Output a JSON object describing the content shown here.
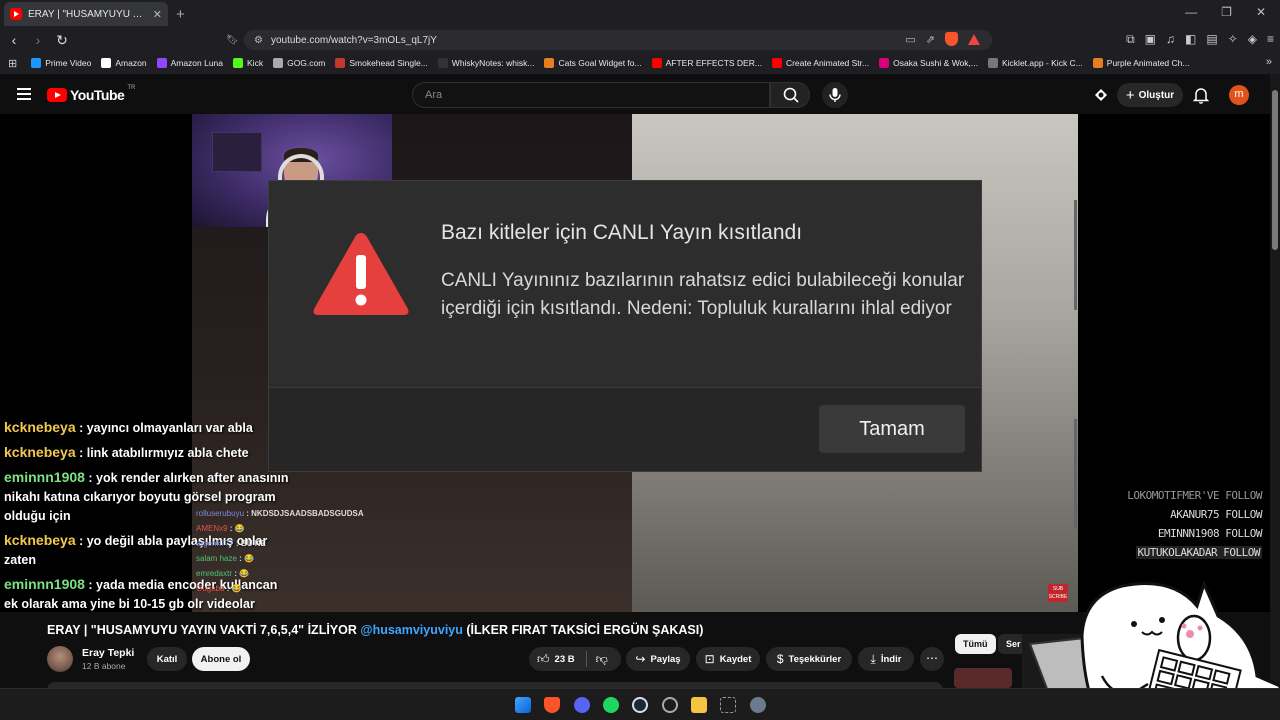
{
  "browser": {
    "tab_title": "ERAY | \"HUSAMYUYU YAYIN VAKT...",
    "url": "youtube.com/watch?v=3mOLs_qL7jY",
    "bookmarks": [
      {
        "label": "Prime Video",
        "color": "#1a98ff"
      },
      {
        "label": "Amazon",
        "color": "#ffffff"
      },
      {
        "label": "Amazon Luna",
        "color": "#9146ff"
      },
      {
        "label": "Kick",
        "color": "#53fc18"
      },
      {
        "label": "GOG.com",
        "color": "#aaaaaa"
      },
      {
        "label": "Smokehead Single...",
        "color": "#c0392b"
      },
      {
        "label": "WhiskyNotes: whisk...",
        "color": "#333333"
      },
      {
        "label": "Cats Goal Widget fo...",
        "color": "#e67e22"
      },
      {
        "label": "AFTER EFFECTS DER...",
        "color": "#ff0000"
      },
      {
        "label": "Create Animated Str...",
        "color": "#ff0000"
      },
      {
        "label": "Osaka Sushi & Wok,...",
        "color": "#d6007e"
      },
      {
        "label": "Kicklet.app - Kick C...",
        "color": "#777777"
      },
      {
        "label": "Purple Animated Ch...",
        "color": "#e67e22"
      }
    ]
  },
  "youtube": {
    "logo_text": "YouTube",
    "logo_suffix": "TR",
    "search_placeholder": "Ara",
    "create_label": "Oluştur",
    "avatar_letter": "m"
  },
  "dialog": {
    "title": "Bazı kitleler için CANLI Yayın kısıtlandı",
    "body": "CANLI Yayınınız bazılarının rahatsız edici bulabileceği konular içerdiği için kısıtlandı. Nedeni: Topluluk kurallarını ihlal ediyor",
    "ok_label": "Tamam"
  },
  "overlay_chat": [
    {
      "user": "kcknebeya",
      "color": "yellow",
      "text": " : yayıncı olmayanları var abla"
    },
    {
      "user": "kcknebeya",
      "color": "yellow",
      "text": " : link atabılırmıyız abla chete"
    },
    {
      "user": "eminnn1908",
      "color": "green",
      "text": " : yok render alırken after anasının nikahı katına cıkarıyor boyutu görsel program olduğu için"
    },
    {
      "user": "kcknebeya",
      "color": "yellow",
      "text": " : yo değil abla paylaşılmış onlar zaten"
    },
    {
      "user": "eminnn1908",
      "color": "green",
      "text": " : yada media encoder kullancan ek olarak ama yine bi 10-15 gb olr videolar"
    }
  ],
  "mini_chat": [
    {
      "user": "rolluserubuyu",
      "text": " : NKDSDJSAADSBADSGUDSA"
    },
    {
      "user": "AMENx9",
      "text": " : 😂"
    },
    {
      "user": "ergenk777",
      "text": " : BU NE"
    },
    {
      "user": "salam haze",
      "text": " : 😂"
    },
    {
      "user": "emredaxtr",
      "text": " : 😂"
    },
    {
      "user": "Gugaba",
      "text": " : 😂"
    }
  ],
  "follows": [
    {
      "text": "LOKOMOTIFMER'VE FOLLOW",
      "style": "dim"
    },
    {
      "text": "AKANUR75 FOLLOW",
      "style": "normal"
    },
    {
      "text": "EMINNN1908 FOLLOW",
      "style": "normal"
    },
    {
      "text": "KUTUKOLAKADAR FOLLOW",
      "style": "hl"
    }
  ],
  "sub_badge": "SUB SCRIBE",
  "video": {
    "title_main": "ERAY | \"HUSAMYUYU YAYIN VAKTİ 7,6,5,4\" İZLİYOR ",
    "title_mention": "@husamviyuviyu",
    "title_tail": " (İLKER FIRAT TAKSİCİ ERGÜN ŞAKASI)",
    "channel_name": "Eray Tepki",
    "channel_subs": "12 B abone",
    "join_label": "Katıl",
    "subscribe_label": "Abone ol",
    "likes": "23 B",
    "share_label": "Paylaş",
    "save_label": "Kaydet",
    "thanks_label": "Teşekkürler",
    "download_label": "İndir"
  },
  "chips": [
    "Tümü",
    "Ser"
  ],
  "colors": {
    "yt_red": "#ff0000",
    "mention_blue": "#3ea6ff",
    "chat_yellow": "#f2c94c",
    "chat_green": "#7ee083",
    "warning_red": "#e5403d"
  }
}
